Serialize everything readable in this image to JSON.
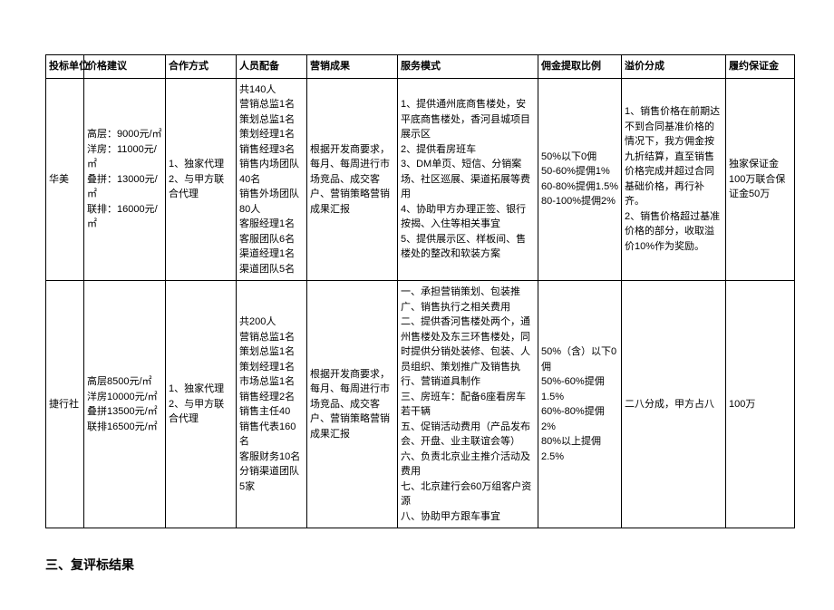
{
  "headers": {
    "bidder": "投标单位",
    "price": "价格建议",
    "coop": "合作方式",
    "staff": "人员配备",
    "result": "营销成果",
    "service": "服务模式",
    "comm": "佣金提取比例",
    "premium": "溢价分成",
    "deposit": "履约保证金"
  },
  "rows": [
    {
      "bidder": "华美",
      "price": [
        "高层：9000元/㎡",
        "洋房：11000元/㎡",
        "叠拼：13000元/㎡",
        "联排：16000元/㎡"
      ],
      "coop": [
        "1、独家代理",
        "2、与甲方联合代理"
      ],
      "staff": [
        "共140人",
        "营销总监1名",
        "策划总监1名",
        "策划经理1名",
        "销售经理3名",
        "销售内场团队40名",
        "销售外场团队80人",
        "客服经理1名",
        "客服团队6名",
        "渠道经理1名",
        "渠道团队5名"
      ],
      "result": "根据开发商要求，每月、每周进行市场竞品、成交客户、营销策略营销成果汇报",
      "service": [
        "1、提供通州底商售楼处，安平底商售楼处，香河县城项目展示区",
        "2、提供看房班车",
        "3、DM单页、短信、分销案场、社区巡展、渠道拓展等费用",
        "4、协助甲方办理正签、银行按揭、入住等相关事宜",
        "5、提供展示区、样板间、售楼处的整改和软装方案"
      ],
      "comm": [
        "50%以下0佣",
        "50-60%提佣1%",
        "60-80%提佣1.5%",
        "80-100%提佣2%"
      ],
      "premium": [
        "1、销售价格在前期达不到合同基准价格的情况下，我方佣金按九折结算，直至销售价格完成并超过合同基础价格，再行补齐。",
        "2、销售价格超过基准价格的部分，收取溢价10%作为奖励。"
      ],
      "deposit": "独家保证金100万联合保证金50万"
    },
    {
      "bidder": "捷行社",
      "price": [
        "高层8500元/㎡",
        "洋房10000元/㎡",
        "叠拼13500元/㎡",
        "联排16500元/㎡"
      ],
      "coop": [
        "1、独家代理",
        "2、与甲方联合代理"
      ],
      "staff": [
        "共200人",
        "营销总监1名",
        "策划总监1名",
        "策划经理1名",
        "市场总监1名",
        "销售经理2名",
        "销售主任40",
        "销售代表160名",
        "客服财务10名",
        "分销渠道团队5家"
      ],
      "result": "根据开发商要求，每月、每周进行市场竞品、成交客户、营销策略营销成果汇报",
      "service": [
        "一、承担营销策划、包装推广、销售执行之相关费用",
        "二、提供香河售楼处两个，通州售楼处及东三环售楼处，同时提供分销处装修、包装、人员组织、策划推广及销售执行、营销道具制作",
        "三、房班车：配备6座看房车若干辆",
        "五、促销活动费用（产品发布会、开盘、业主联谊会等）",
        "六、负责北京业主推介活动及费用",
        "七、北京建行会60万组客户资源",
        "八、协助甲方跟车事宜"
      ],
      "comm": [
        "50%（含）以下0佣",
        "50%-60%提佣1.5%",
        "60%-80%提佣2%",
        "80%以上提佣2.5%"
      ],
      "premium": [
        "二八分成，甲方占八"
      ],
      "deposit": "100万"
    }
  ],
  "section_title": "三、复评标结果"
}
